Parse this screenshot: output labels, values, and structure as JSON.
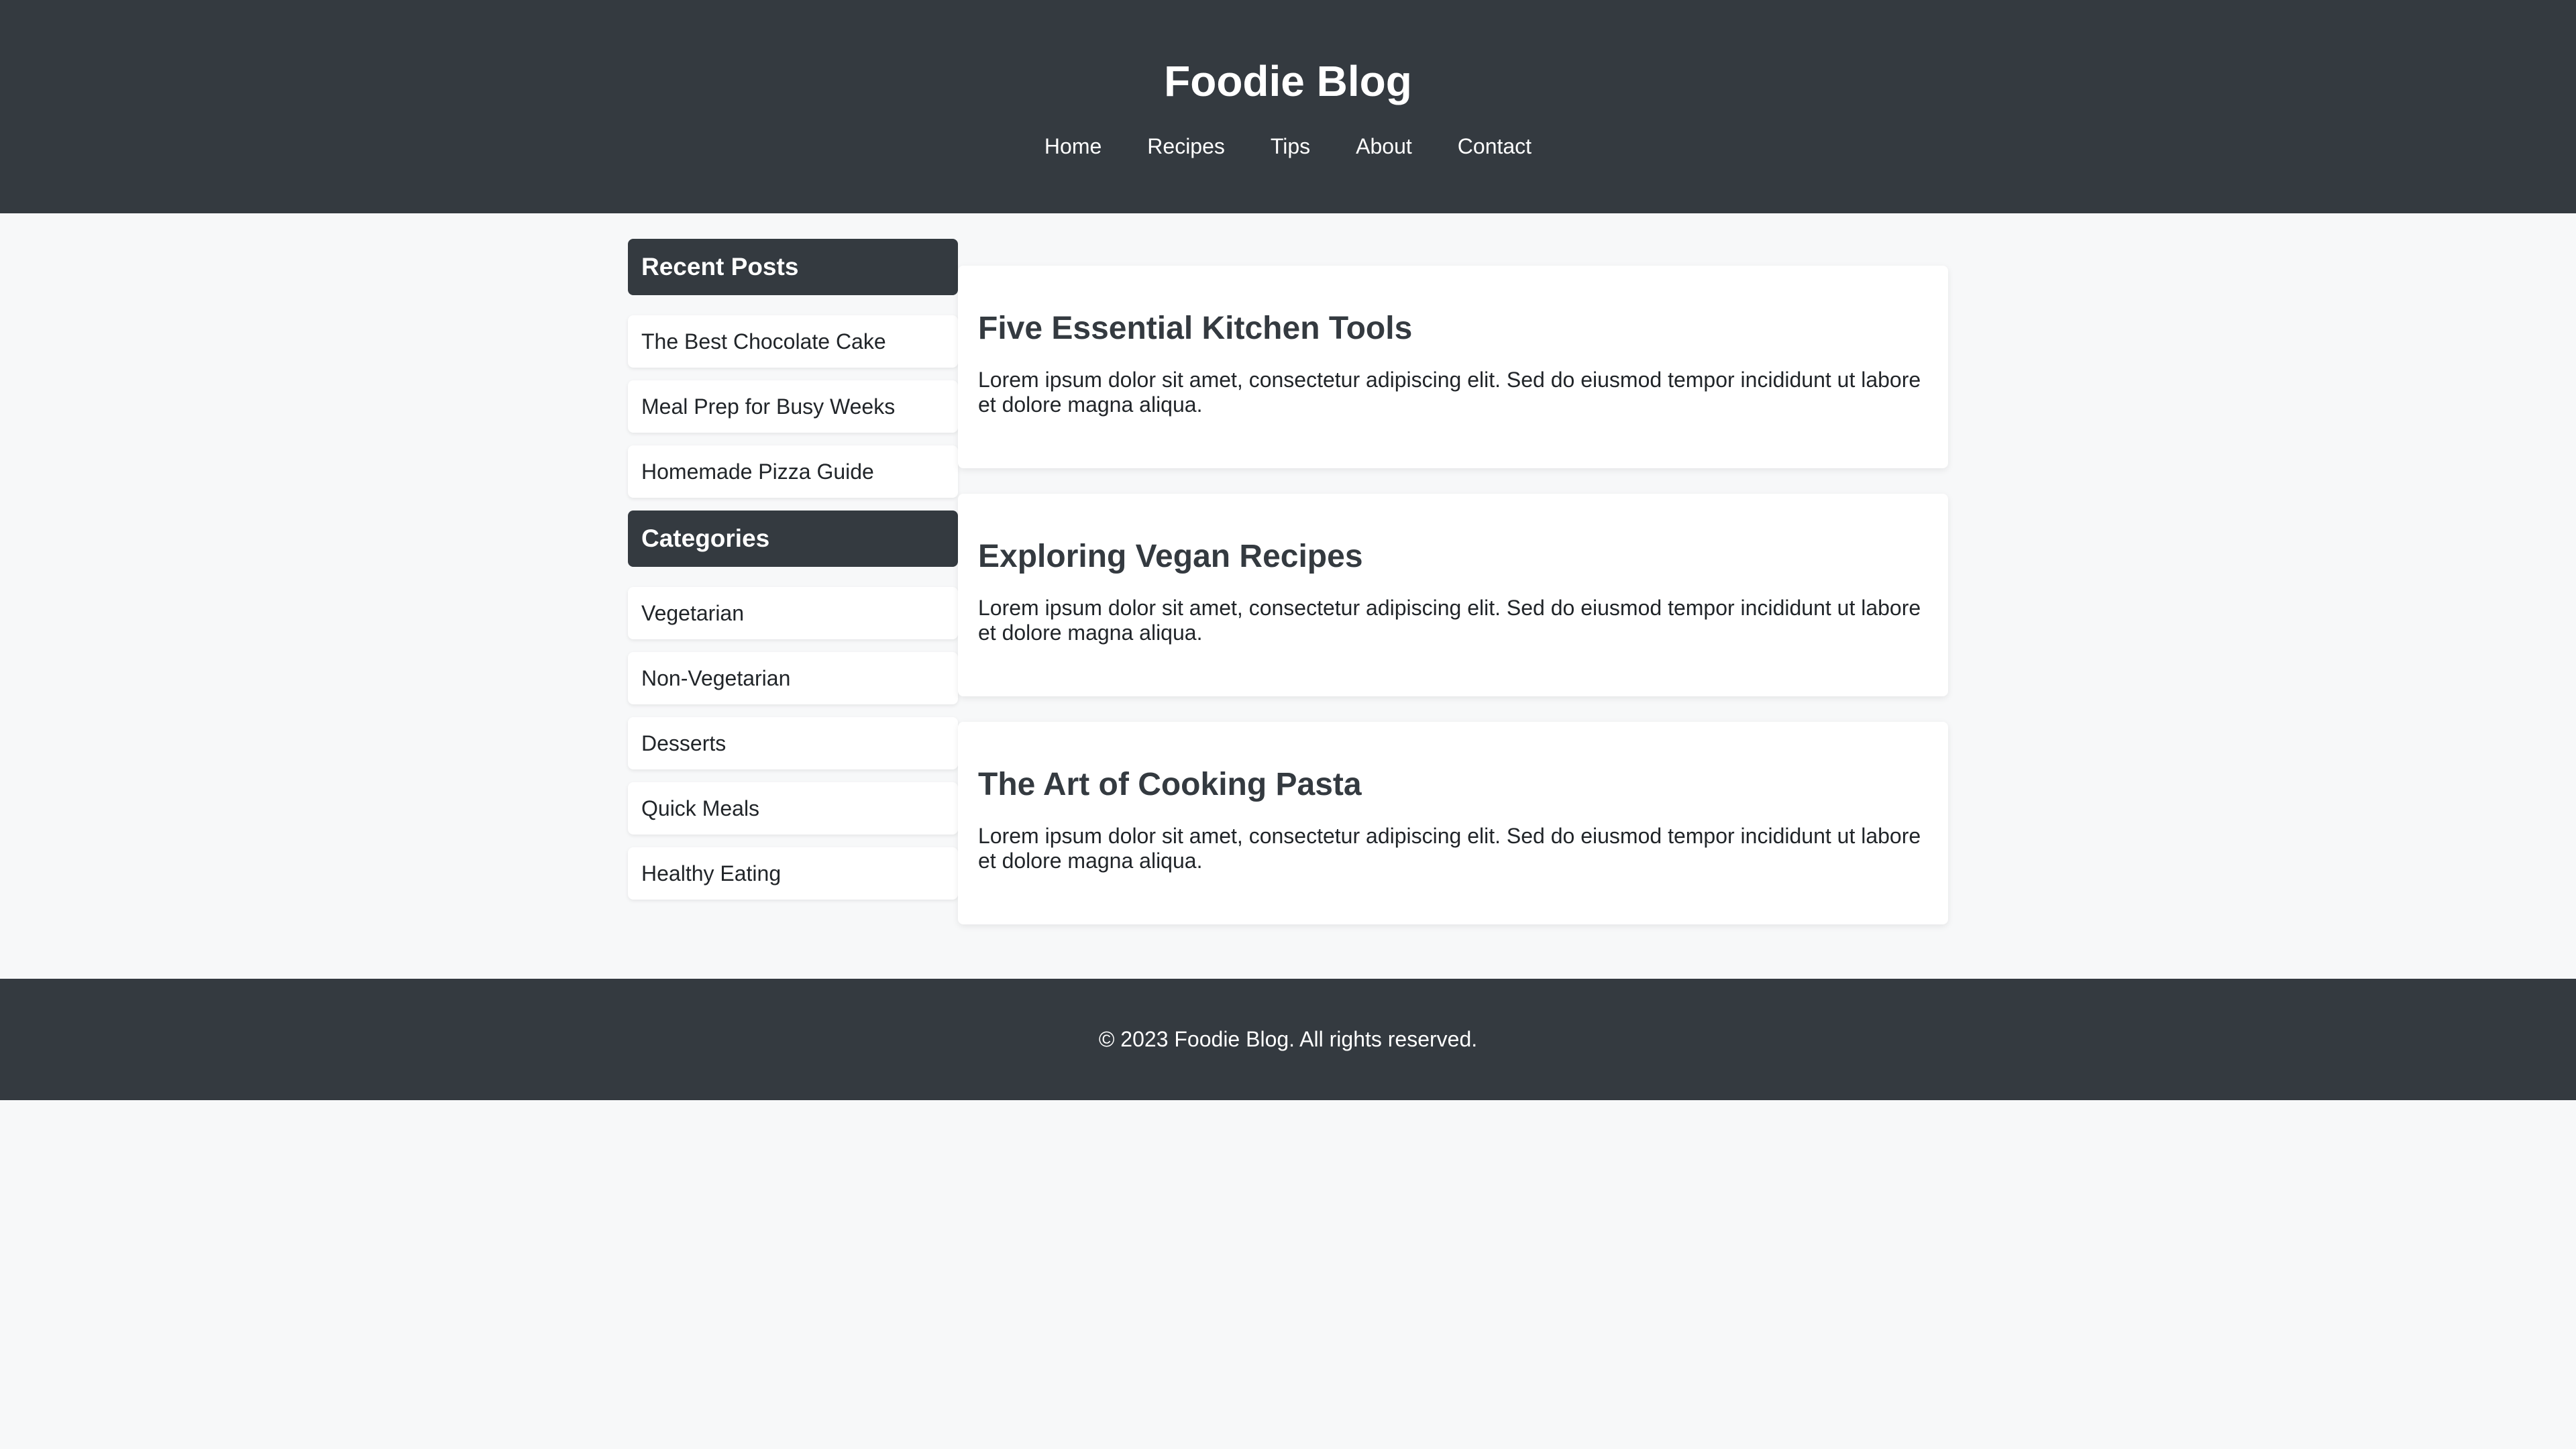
{
  "header": {
    "title": "Foodie Blog",
    "nav": [
      "Home",
      "Recipes",
      "Tips",
      "About",
      "Contact"
    ]
  },
  "sidebar": {
    "recent_posts": {
      "heading": "Recent Posts",
      "items": [
        "The Best Chocolate Cake",
        "Meal Prep for Busy Weeks",
        "Homemade Pizza Guide"
      ]
    },
    "categories": {
      "heading": "Categories",
      "items": [
        "Vegetarian",
        "Non-Vegetarian",
        "Desserts",
        "Quick Meals",
        "Healthy Eating"
      ]
    }
  },
  "main": {
    "posts": [
      {
        "title": "Five Essential Kitchen Tools",
        "excerpt": "Lorem ipsum dolor sit amet, consectetur adipiscing elit. Sed do eiusmod tempor incididunt ut labore et dolore magna aliqua."
      },
      {
        "title": "Exploring Vegan Recipes",
        "excerpt": "Lorem ipsum dolor sit amet, consectetur adipiscing elit. Sed do eiusmod tempor incididunt ut labore et dolore magna aliqua."
      },
      {
        "title": "The Art of Cooking Pasta",
        "excerpt": "Lorem ipsum dolor sit amet, consectetur adipiscing elit. Sed do eiusmod tempor incididunt ut labore et dolore magna aliqua."
      }
    ]
  },
  "footer": {
    "text": "© 2023 Foodie Blog. All rights reserved."
  },
  "colors": {
    "header_bg": "#343a40",
    "page_bg": "#f7f8f9",
    "card_bg": "#ffffff",
    "text": "#212529"
  }
}
